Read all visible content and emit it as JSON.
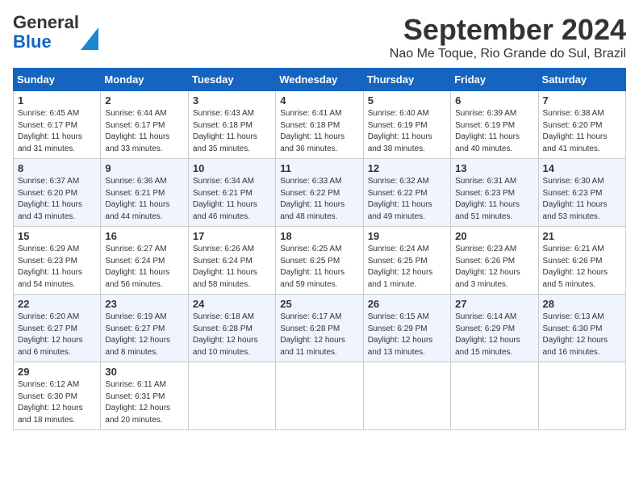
{
  "logo": {
    "line1": "General",
    "line2": "Blue"
  },
  "title": "September 2024",
  "location": "Nao Me Toque, Rio Grande do Sul, Brazil",
  "days_of_week": [
    "Sunday",
    "Monday",
    "Tuesday",
    "Wednesday",
    "Thursday",
    "Friday",
    "Saturday"
  ],
  "weeks": [
    [
      {
        "day": "1",
        "info": "Sunrise: 6:45 AM\nSunset: 6:17 PM\nDaylight: 11 hours\nand 31 minutes."
      },
      {
        "day": "2",
        "info": "Sunrise: 6:44 AM\nSunset: 6:17 PM\nDaylight: 11 hours\nand 33 minutes."
      },
      {
        "day": "3",
        "info": "Sunrise: 6:43 AM\nSunset: 6:18 PM\nDaylight: 11 hours\nand 35 minutes."
      },
      {
        "day": "4",
        "info": "Sunrise: 6:41 AM\nSunset: 6:18 PM\nDaylight: 11 hours\nand 36 minutes."
      },
      {
        "day": "5",
        "info": "Sunrise: 6:40 AM\nSunset: 6:19 PM\nDaylight: 11 hours\nand 38 minutes."
      },
      {
        "day": "6",
        "info": "Sunrise: 6:39 AM\nSunset: 6:19 PM\nDaylight: 11 hours\nand 40 minutes."
      },
      {
        "day": "7",
        "info": "Sunrise: 6:38 AM\nSunset: 6:20 PM\nDaylight: 11 hours\nand 41 minutes."
      }
    ],
    [
      {
        "day": "8",
        "info": "Sunrise: 6:37 AM\nSunset: 6:20 PM\nDaylight: 11 hours\nand 43 minutes."
      },
      {
        "day": "9",
        "info": "Sunrise: 6:36 AM\nSunset: 6:21 PM\nDaylight: 11 hours\nand 44 minutes."
      },
      {
        "day": "10",
        "info": "Sunrise: 6:34 AM\nSunset: 6:21 PM\nDaylight: 11 hours\nand 46 minutes."
      },
      {
        "day": "11",
        "info": "Sunrise: 6:33 AM\nSunset: 6:22 PM\nDaylight: 11 hours\nand 48 minutes."
      },
      {
        "day": "12",
        "info": "Sunrise: 6:32 AM\nSunset: 6:22 PM\nDaylight: 11 hours\nand 49 minutes."
      },
      {
        "day": "13",
        "info": "Sunrise: 6:31 AM\nSunset: 6:23 PM\nDaylight: 11 hours\nand 51 minutes."
      },
      {
        "day": "14",
        "info": "Sunrise: 6:30 AM\nSunset: 6:23 PM\nDaylight: 11 hours\nand 53 minutes."
      }
    ],
    [
      {
        "day": "15",
        "info": "Sunrise: 6:29 AM\nSunset: 6:23 PM\nDaylight: 11 hours\nand 54 minutes."
      },
      {
        "day": "16",
        "info": "Sunrise: 6:27 AM\nSunset: 6:24 PM\nDaylight: 11 hours\nand 56 minutes."
      },
      {
        "day": "17",
        "info": "Sunrise: 6:26 AM\nSunset: 6:24 PM\nDaylight: 11 hours\nand 58 minutes."
      },
      {
        "day": "18",
        "info": "Sunrise: 6:25 AM\nSunset: 6:25 PM\nDaylight: 11 hours\nand 59 minutes."
      },
      {
        "day": "19",
        "info": "Sunrise: 6:24 AM\nSunset: 6:25 PM\nDaylight: 12 hours\nand 1 minute."
      },
      {
        "day": "20",
        "info": "Sunrise: 6:23 AM\nSunset: 6:26 PM\nDaylight: 12 hours\nand 3 minutes."
      },
      {
        "day": "21",
        "info": "Sunrise: 6:21 AM\nSunset: 6:26 PM\nDaylight: 12 hours\nand 5 minutes."
      }
    ],
    [
      {
        "day": "22",
        "info": "Sunrise: 6:20 AM\nSunset: 6:27 PM\nDaylight: 12 hours\nand 6 minutes."
      },
      {
        "day": "23",
        "info": "Sunrise: 6:19 AM\nSunset: 6:27 PM\nDaylight: 12 hours\nand 8 minutes."
      },
      {
        "day": "24",
        "info": "Sunrise: 6:18 AM\nSunset: 6:28 PM\nDaylight: 12 hours\nand 10 minutes."
      },
      {
        "day": "25",
        "info": "Sunrise: 6:17 AM\nSunset: 6:28 PM\nDaylight: 12 hours\nand 11 minutes."
      },
      {
        "day": "26",
        "info": "Sunrise: 6:15 AM\nSunset: 6:29 PM\nDaylight: 12 hours\nand 13 minutes."
      },
      {
        "day": "27",
        "info": "Sunrise: 6:14 AM\nSunset: 6:29 PM\nDaylight: 12 hours\nand 15 minutes."
      },
      {
        "day": "28",
        "info": "Sunrise: 6:13 AM\nSunset: 6:30 PM\nDaylight: 12 hours\nand 16 minutes."
      }
    ],
    [
      {
        "day": "29",
        "info": "Sunrise: 6:12 AM\nSunset: 6:30 PM\nDaylight: 12 hours\nand 18 minutes."
      },
      {
        "day": "30",
        "info": "Sunrise: 6:11 AM\nSunset: 6:31 PM\nDaylight: 12 hours\nand 20 minutes."
      },
      null,
      null,
      null,
      null,
      null
    ]
  ]
}
